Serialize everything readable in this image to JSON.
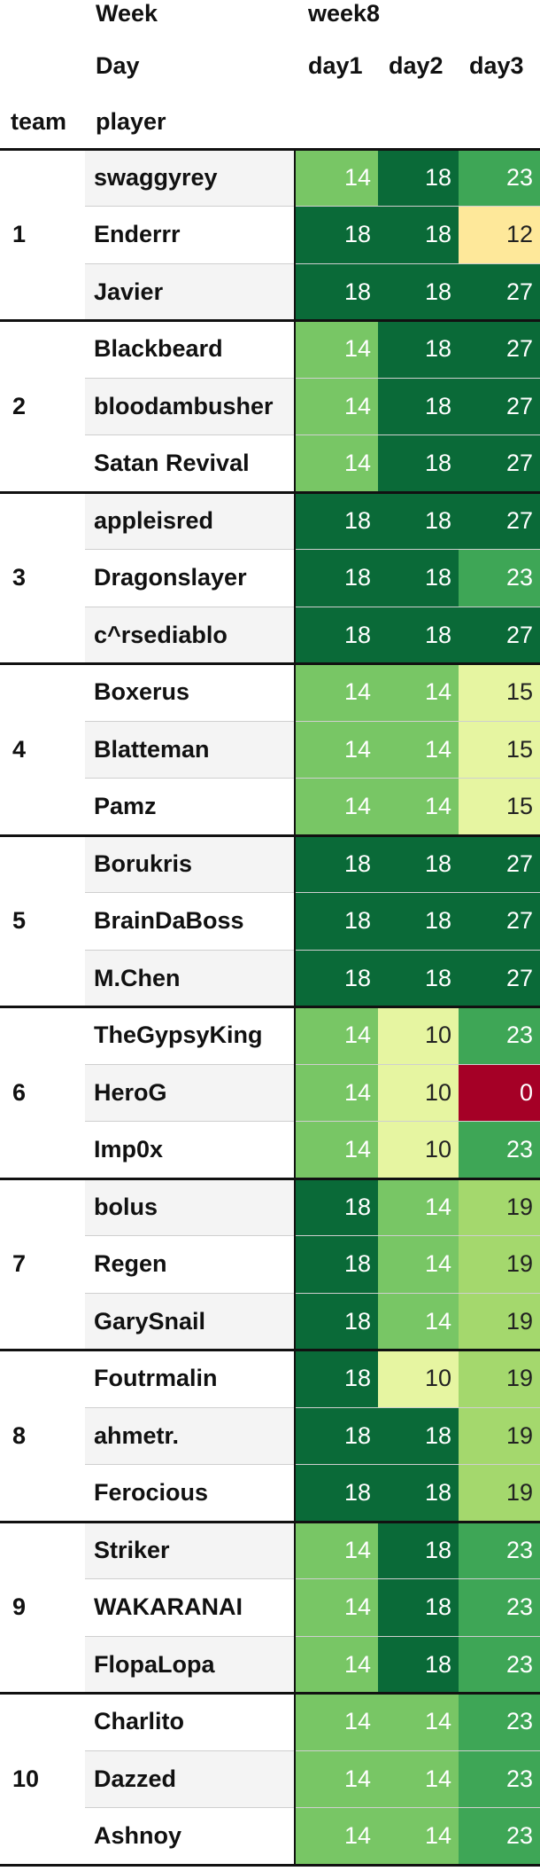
{
  "header": {
    "week_label": "Week",
    "week_value": "week8",
    "day_label": "Day",
    "days": [
      "day1",
      "day2",
      "day3"
    ],
    "team_label": "team",
    "player_label": "player"
  },
  "chart_data": {
    "type": "table",
    "title": "",
    "columns": [
      "day1",
      "day2",
      "day3"
    ],
    "teams": [
      {
        "team": "1",
        "players": [
          {
            "name": "swaggyrey",
            "values": [
              14,
              18,
              23
            ]
          },
          {
            "name": "Enderrr",
            "values": [
              18,
              18,
              12
            ]
          },
          {
            "name": "Javier",
            "values": [
              18,
              18,
              27
            ]
          }
        ]
      },
      {
        "team": "2",
        "players": [
          {
            "name": "Blackbeard",
            "values": [
              14,
              18,
              27
            ]
          },
          {
            "name": "bloodambusher",
            "values": [
              14,
              18,
              27
            ]
          },
          {
            "name": "Satan Revival",
            "values": [
              14,
              18,
              27
            ]
          }
        ]
      },
      {
        "team": "3",
        "players": [
          {
            "name": "appleisred",
            "values": [
              18,
              18,
              27
            ]
          },
          {
            "name": "Dragonslayer",
            "values": [
              18,
              18,
              23
            ]
          },
          {
            "name": "c^rsediablo",
            "values": [
              18,
              18,
              27
            ]
          }
        ]
      },
      {
        "team": "4",
        "players": [
          {
            "name": "Boxerus",
            "values": [
              14,
              14,
              15
            ]
          },
          {
            "name": "Blatteman",
            "values": [
              14,
              14,
              15
            ]
          },
          {
            "name": "Pamz",
            "values": [
              14,
              14,
              15
            ]
          }
        ]
      },
      {
        "team": "5",
        "players": [
          {
            "name": "Borukris",
            "values": [
              18,
              18,
              27
            ]
          },
          {
            "name": "BrainDaBoss",
            "values": [
              18,
              18,
              27
            ]
          },
          {
            "name": "M.Chen",
            "values": [
              18,
              18,
              27
            ]
          }
        ]
      },
      {
        "team": "6",
        "players": [
          {
            "name": "TheGypsyKing",
            "values": [
              14,
              10,
              23
            ]
          },
          {
            "name": "HeroG",
            "values": [
              14,
              10,
              0
            ]
          },
          {
            "name": "Imp0x",
            "values": [
              14,
              10,
              23
            ]
          }
        ]
      },
      {
        "team": "7",
        "players": [
          {
            "name": "bolus",
            "values": [
              18,
              14,
              19
            ]
          },
          {
            "name": "Regen",
            "values": [
              18,
              14,
              19
            ]
          },
          {
            "name": "GarySnail",
            "values": [
              18,
              14,
              19
            ]
          }
        ]
      },
      {
        "team": "8",
        "players": [
          {
            "name": "Foutrmalin",
            "values": [
              18,
              10,
              19
            ]
          },
          {
            "name": "ahmetr.",
            "values": [
              18,
              18,
              19
            ]
          },
          {
            "name": "Ferocious",
            "values": [
              18,
              18,
              19
            ]
          }
        ]
      },
      {
        "team": "9",
        "players": [
          {
            "name": "Striker",
            "values": [
              14,
              18,
              23
            ]
          },
          {
            "name": "WAKARANAI",
            "values": [
              14,
              18,
              23
            ]
          },
          {
            "name": "FlopaLopa",
            "values": [
              14,
              18,
              23
            ]
          }
        ]
      },
      {
        "team": "10",
        "players": [
          {
            "name": "Charlito",
            "values": [
              14,
              14,
              23
            ]
          },
          {
            "name": "Dazzed",
            "values": [
              14,
              14,
              23
            ]
          },
          {
            "name": "Ashnoy",
            "values": [
              14,
              14,
              23
            ]
          }
        ]
      }
    ]
  },
  "colors": {
    "0": "#a50026",
    "10": "#e6f5a1",
    "12": "#fee89a",
    "14": "#78c665",
    "15": "#e6f5a1",
    "18": "#0a6a38",
    "19": "#a4d86d",
    "23": "#3ea656",
    "27": "#0a6a38",
    "stripe": "#f4f4f4",
    "white": "#ffffff",
    "text_light": "#ffffff",
    "text_dark": "#222222",
    "rule": "#111111"
  }
}
